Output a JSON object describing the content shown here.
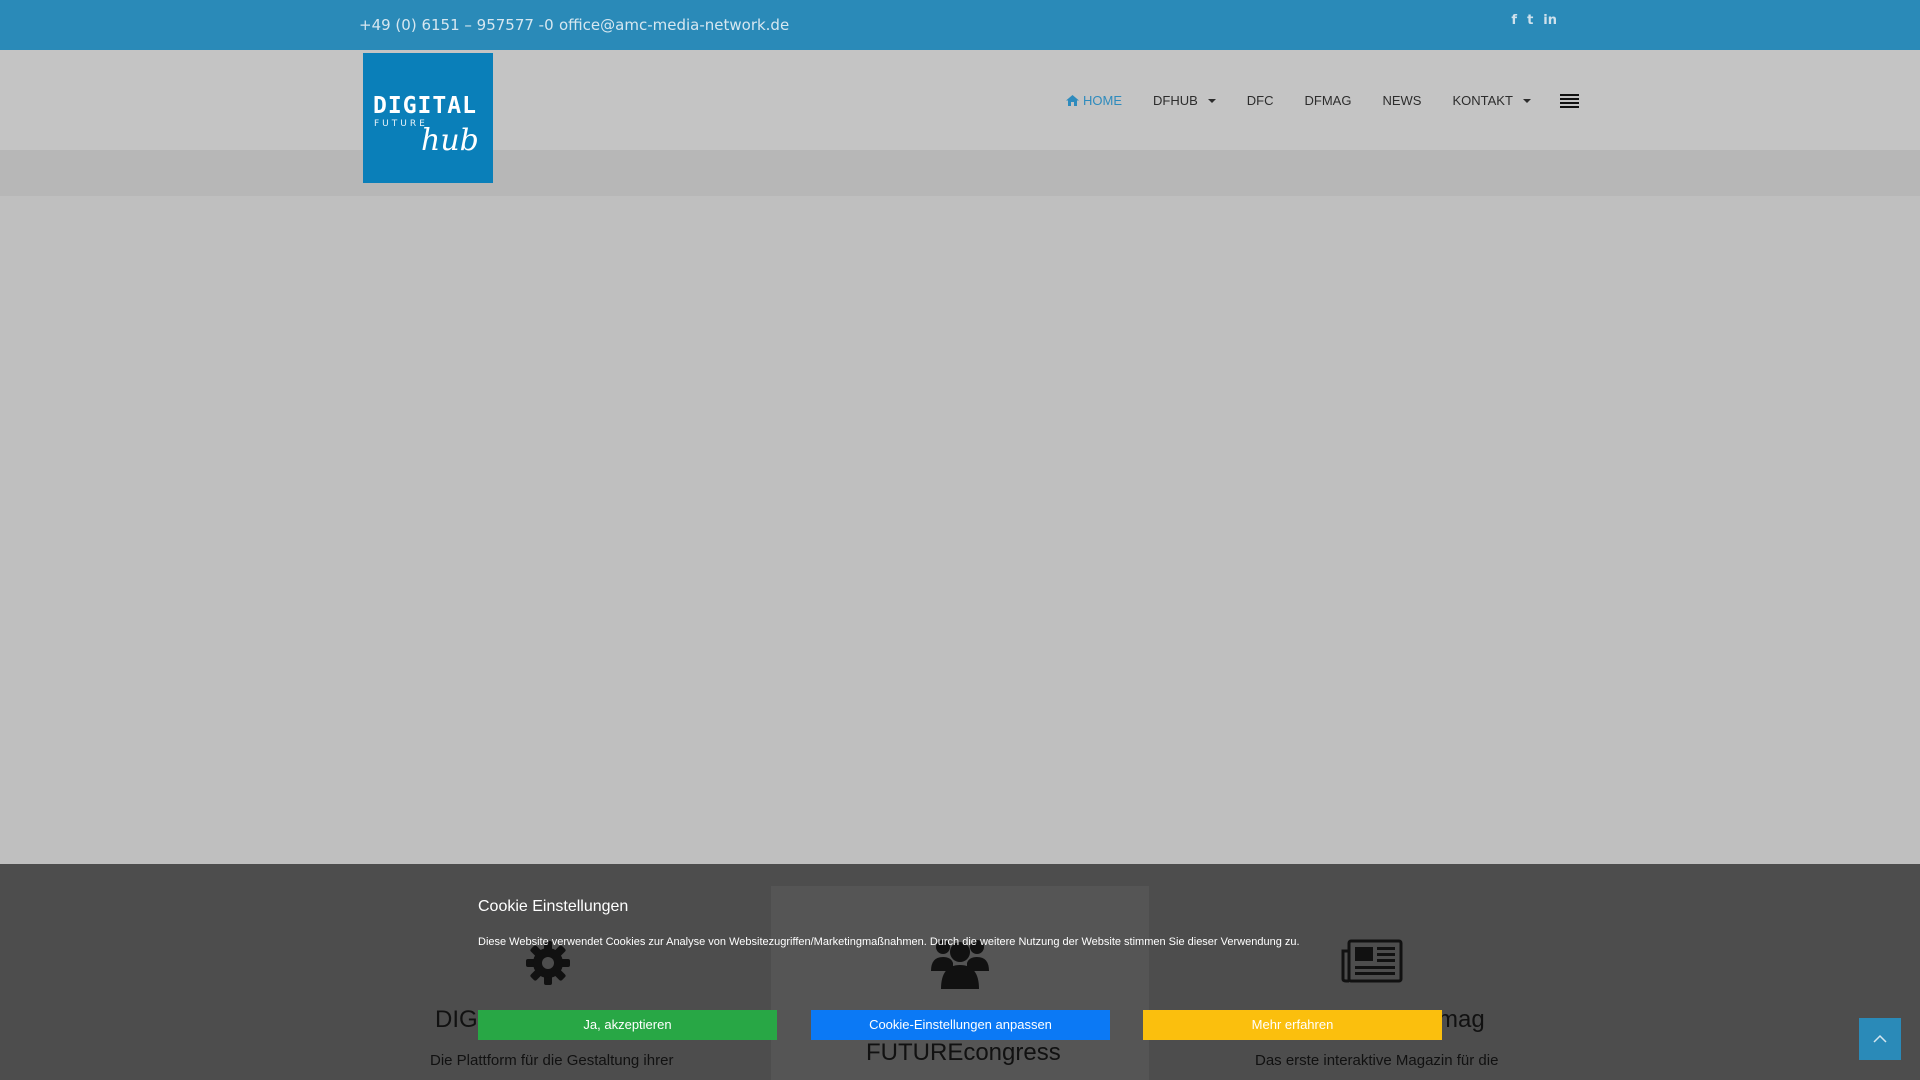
{
  "topbar": {
    "phone": "+49 (0) 6151 – 957577 -0",
    "email": "office@amc-media-network.de",
    "social_icons": [
      "facebook-icon",
      "twitter-icon",
      "linkedin-icon"
    ],
    "social_glyphs": [
      "f",
      "t",
      "in"
    ]
  },
  "logo": {
    "line1": "DIGITAL",
    "line2": "FUTURE",
    "line3": "hub"
  },
  "nav": {
    "items": [
      {
        "label": "HOME",
        "active": true
      },
      {
        "label": "DFHUB",
        "dropdown": true
      },
      {
        "label": "DFC"
      },
      {
        "label": "DFMAG"
      },
      {
        "label": "NEWS"
      },
      {
        "label": "KONTAKT",
        "dropdown": true
      }
    ],
    "menu_icon": "hamburger-icon"
  },
  "features": [
    {
      "icon": "gear-icon",
      "title": "DIG",
      "desc": "Die Plattform für die Gestaltung ihrer"
    },
    {
      "icon": "users-icon",
      "title": "FUTUREcongress",
      "desc": ""
    },
    {
      "icon": "newspaper-icon",
      "title": "mag",
      "desc": "Das erste interaktive Magazin für die"
    }
  ],
  "cookie": {
    "title": "Cookie Einstellungen",
    "text": "Diese Website verwendet Cookies zur Analyse von Websitezugriffen/Marketingmaßnahmen. Durch die weitere Nutzung der Website stimmen Sie dieser Verwendung zu.",
    "accept_label": "Ja, akzeptieren",
    "settings_label": "Cookie-Einstellungen anpassen",
    "more_label": "Mehr erfahren"
  },
  "colors": {
    "topbar": "#2a8ab8",
    "logo": "#0a7fb9",
    "accept": "#28a745",
    "settings": "#0b79f5",
    "more": "#fbbf0d"
  }
}
